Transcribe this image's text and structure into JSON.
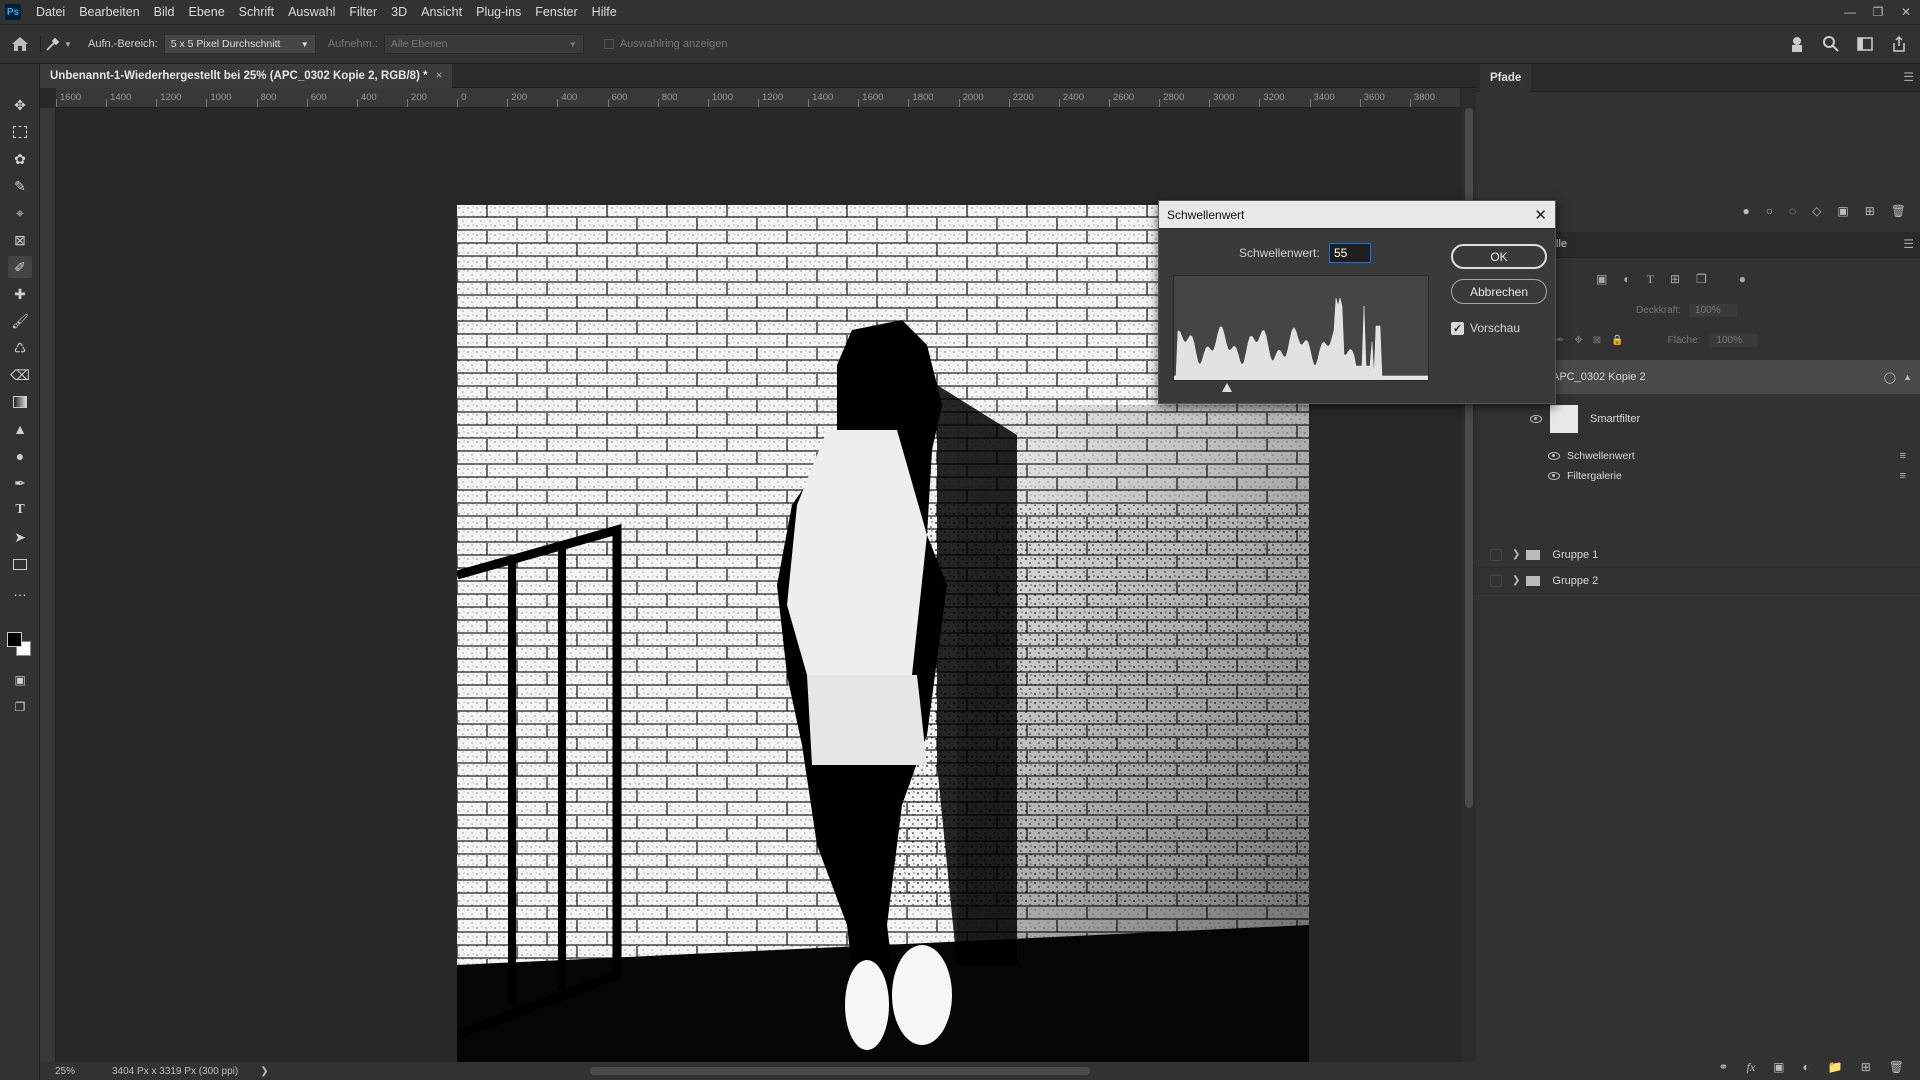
{
  "app": {
    "logo": "Ps"
  },
  "menu": [
    "Datei",
    "Bearbeiten",
    "Bild",
    "Ebene",
    "Schrift",
    "Auswahl",
    "Filter",
    "3D",
    "Ansicht",
    "Plug-ins",
    "Fenster",
    "Hilfe"
  ],
  "options": {
    "sample_size_label": "Aufn.-Bereich:",
    "sample_size_value": "5 x 5 Pixel Durchschnitt",
    "sample_label": "Aufnehm.:",
    "sample_value": "Alle Ebenen",
    "show_ring_label": "Auswahlring anzeigen"
  },
  "document": {
    "tab_title": "Unbenannt-1-Wiederhergestellt bei 25% (APC_0302 Kopie 2, RGB/8) *",
    "close_glyph": "×"
  },
  "ruler": {
    "h_ticks": [
      "1600",
      "1400",
      "1200",
      "1000",
      "800",
      "600",
      "400",
      "200",
      "0",
      "200",
      "400",
      "600",
      "800",
      "1000",
      "1200",
      "1400",
      "1600",
      "1800",
      "2000",
      "2200",
      "2400",
      "2600",
      "2800",
      "3000",
      "3200",
      "3400",
      "3600",
      "3800"
    ]
  },
  "status": {
    "zoom": "25%",
    "doc_size": "3404 Px x 3319 Px (300 ppi)"
  },
  "dialog": {
    "title": "Schwellenwert",
    "threshold_label": "Schwellenwert:",
    "threshold_value": "55",
    "threshold_fraction": 0.21,
    "ok": "OK",
    "cancel": "Abbrechen",
    "preview_label": "Vorschau",
    "preview_checked": true
  },
  "panels": {
    "top_tab": "Pfade",
    "layers_tab_fragment": "lle",
    "opacity_label": "Deckkraft:",
    "opacity_value": "100%",
    "fill_label": "Fläche:",
    "fill_value": "100%",
    "layers": [
      {
        "name": "APC_0302 Kopie 2"
      },
      {
        "name": "Smartfilter"
      },
      {
        "name": "Schwellenwert"
      },
      {
        "name": "Filtergalerie"
      },
      {
        "name": "Gruppe 1"
      },
      {
        "name": "Gruppe 2"
      }
    ]
  },
  "colors": {
    "accent": "#1473e6",
    "panel": "#323232",
    "bg": "#282828"
  },
  "icons": [
    "home-icon",
    "eyedropper-icon",
    "move-icon",
    "marquee-icon",
    "lasso-icon",
    "quick-select-icon",
    "crop-icon",
    "frame-icon",
    "eyedropper-tool-icon",
    "healing-icon",
    "brush-icon",
    "stamp-icon",
    "eraser-icon",
    "gradient-icon",
    "blur-icon",
    "dodge-icon",
    "pen-icon",
    "type-icon",
    "path-select-icon",
    "shape-icon",
    "more-icon",
    "search-icon",
    "share-icon",
    "eye-icon",
    "folder-icon",
    "link-icon",
    "fx-icon",
    "mask-icon",
    "new-layer-icon",
    "trash-icon"
  ]
}
